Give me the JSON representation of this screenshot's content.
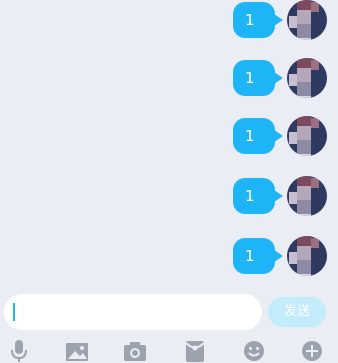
{
  "messages": [
    {
      "text": "1"
    },
    {
      "text": "1"
    },
    {
      "text": "1"
    },
    {
      "text": "1"
    },
    {
      "text": "1"
    }
  ],
  "composer": {
    "input_value": "",
    "send_label": "发送"
  },
  "toolbar": {
    "items": [
      {
        "icon": "microphone-icon"
      },
      {
        "icon": "image-icon"
      },
      {
        "icon": "camera-icon"
      },
      {
        "icon": "red-packet-icon"
      },
      {
        "icon": "emoji-icon"
      },
      {
        "icon": "plus-icon"
      }
    ]
  },
  "colors": {
    "background": "#eaedf3",
    "bubble": "#1eb5f7",
    "send_button": "#c2ecfc",
    "icon": "#9da3ae"
  }
}
